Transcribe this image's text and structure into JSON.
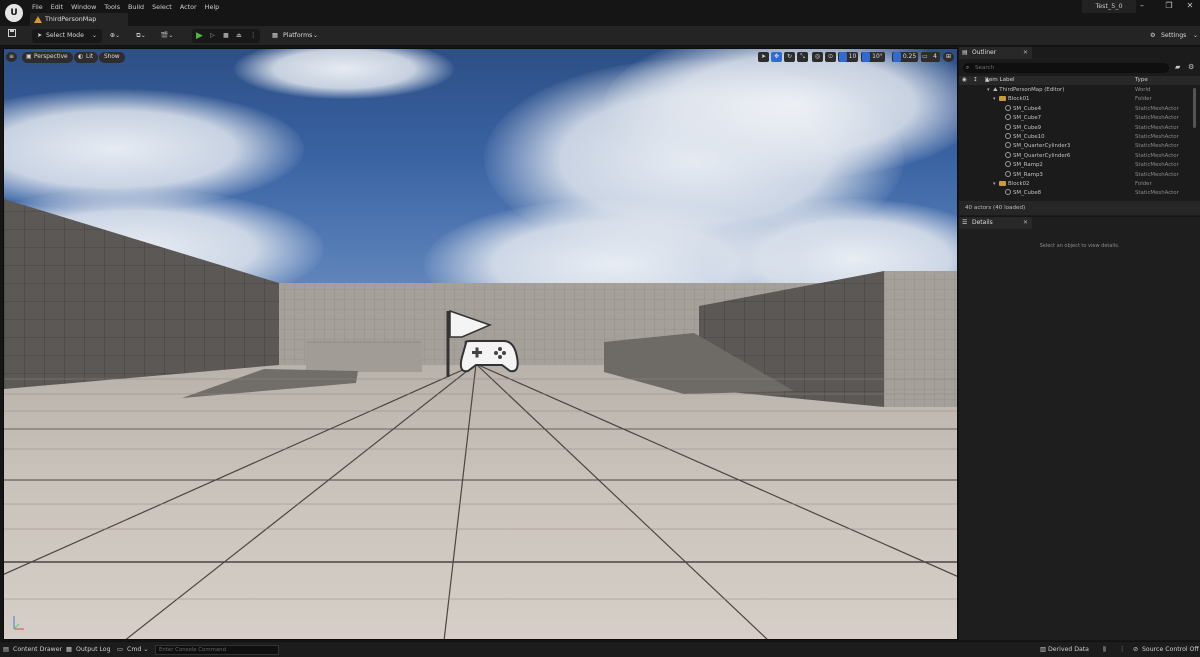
{
  "menu": [
    "File",
    "Edit",
    "Window",
    "Tools",
    "Build",
    "Select",
    "Actor",
    "Help"
  ],
  "map_tab": "ThirdPersonMap",
  "project_name": "Test_5_0",
  "toolbar": {
    "select_mode": "Select Mode",
    "platforms": "Platforms",
    "settings": "Settings"
  },
  "viewport": {
    "perspective": "Perspective",
    "lit": "Lit",
    "show": "Show",
    "grid_size": "10",
    "rotation_snap": "10°",
    "scale_snap": "0.25",
    "camera_speed": "4"
  },
  "outliner": {
    "tab": "Outliner",
    "search_placeholder": "Search",
    "col_label": "Item Label",
    "col_type": "Type",
    "rows": [
      {
        "label": "ThirdPersonMap (Editor)",
        "type": "World"
      },
      {
        "label": "Block01",
        "type": "Folder"
      },
      {
        "label": "SM_Cube4",
        "type": "StaticMeshActor"
      },
      {
        "label": "SM_Cube7",
        "type": "StaticMeshActor"
      },
      {
        "label": "SM_Cube9",
        "type": "StaticMeshActor"
      },
      {
        "label": "SM_Cube10",
        "type": "StaticMeshActor"
      },
      {
        "label": "SM_QuarterCylinder3",
        "type": "StaticMeshActor"
      },
      {
        "label": "SM_QuarterCylinder6",
        "type": "StaticMeshActor"
      },
      {
        "label": "SM_Ramp2",
        "type": "StaticMeshActor"
      },
      {
        "label": "SM_Ramp3",
        "type": "StaticMeshActor"
      },
      {
        "label": "Block02",
        "type": "Folder"
      },
      {
        "label": "SM_Cube8",
        "type": "StaticMeshActor"
      }
    ],
    "count": "40 actors (40 loaded)"
  },
  "details": {
    "tab": "Details",
    "empty": "Select an object to view details."
  },
  "statusbar": {
    "content_drawer": "Content Drawer",
    "output_log": "Output Log",
    "cmd": "Cmd",
    "console_placeholder": "Enter Console Command",
    "derived_data": "Derived Data",
    "source_control": "Source Control Off"
  },
  "colors": {
    "play_green": "#4fb543",
    "folder": "#c99a3c",
    "accent_blue": "#2f6bd1"
  }
}
